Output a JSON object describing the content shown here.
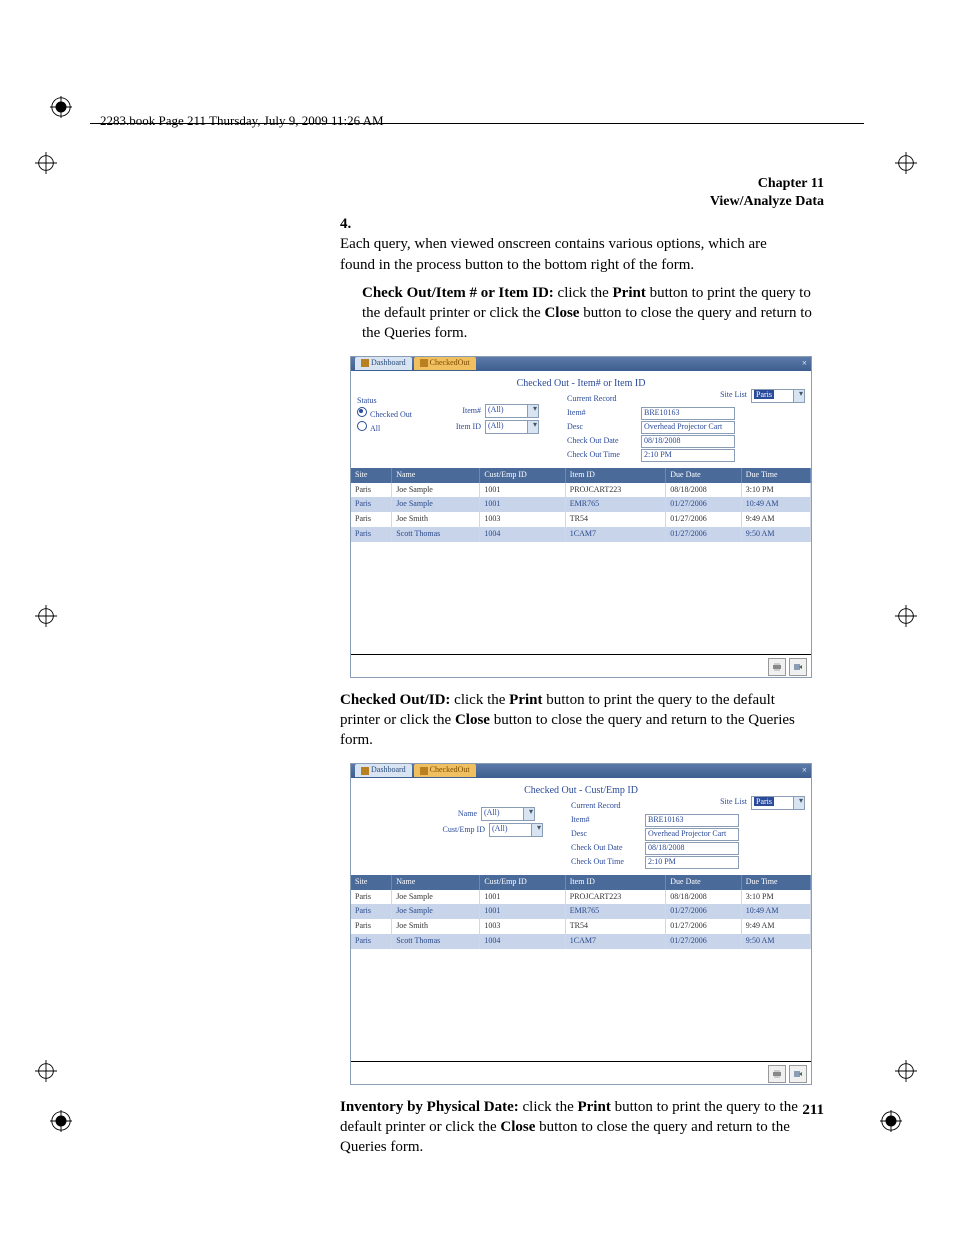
{
  "page_header": "2283.book  Page 211  Thursday, July 9, 2009  11:26 AM",
  "chapter": {
    "num": "Chapter 11",
    "title": "View/Analyze Data"
  },
  "page_number": "211",
  "step_number": "4.",
  "step_text": "Each query, when viewed onscreen contains various options, which are found in the process button to the bottom right of the form.",
  "para1": {
    "bold": "Check Out/Item # or Item ID:",
    "rest": " click the ",
    "b2": "Print",
    "rest2": " button to print the query to the default printer or click the ",
    "b3": "Close",
    "rest3": " button to close the query and return to the Queries form."
  },
  "para2": {
    "bold": "Checked Out/ID:",
    "rest": " click the ",
    "b2": "Print",
    "rest2": " button to print the query to the default printer or click the ",
    "b3": "Close",
    "rest3": " button to close the query and return to the Queries form."
  },
  "para3": {
    "bold": "Inventory by Physical Date:",
    "rest": " click the ",
    "b2": "Print",
    "rest2": " button to print the query to the default printer or click the ",
    "b3": "Close",
    "rest3": " button to close the query and return to the Queries form."
  },
  "shot1": {
    "tabs": {
      "dashboard": "Dashboard",
      "active": "CheckedOut"
    },
    "title": "Checked Out - Item# or Item ID",
    "site_label": "Site List",
    "site_value": "Paris",
    "status_label": "Status",
    "status_opts": {
      "checked_out": "Checked Out",
      "all": "All"
    },
    "filters": {
      "item_num_label": "Item#",
      "item_id_label": "Item ID",
      "all": "(All)"
    },
    "current": {
      "title": "Current Record",
      "item_num_label": "Item#",
      "item_num": "BRE10163",
      "desc_label": "Desc",
      "desc": "Overhead Projector Cart",
      "cod_label": "Check Out Date",
      "cod": "08/18/2008",
      "cot_label": "Check Out Time",
      "cot": "2:10 PM"
    },
    "cols": {
      "site": "Site",
      "name": "Name",
      "custemp": "Cust/Emp ID",
      "itemid": "Item ID",
      "duedate": "Due Date",
      "duetime": "Due Time"
    },
    "rows": [
      {
        "site": "Paris",
        "name": "Joe Sample",
        "cust": "1001",
        "item": "PROJCART223",
        "dd": "08/18/2008",
        "dt": "3:10 PM"
      },
      {
        "site": "Paris",
        "name": "Joe Sample",
        "cust": "1001",
        "item": "EMR765",
        "dd": "01/27/2006",
        "dt": "10:49 AM"
      },
      {
        "site": "Paris",
        "name": "Joe Smith",
        "cust": "1003",
        "item": "TR54",
        "dd": "01/27/2006",
        "dt": "9:49 AM"
      },
      {
        "site": "Paris",
        "name": "Scott Thomas",
        "cust": "1004",
        "item": "1CAM7",
        "dd": "01/27/2006",
        "dt": "9:50 AM"
      }
    ]
  },
  "shot2": {
    "tabs": {
      "dashboard": "Dashboard",
      "active": "CheckedOut"
    },
    "title": "Checked Out - Cust/Emp ID",
    "site_label": "Site List",
    "site_value": "Paris",
    "filters": {
      "name_label": "Name",
      "custemp_label": "Cust/Emp ID",
      "all": "(All)"
    },
    "current": {
      "title": "Current Record",
      "item_num_label": "Item#",
      "item_num": "BRE10163",
      "desc_label": "Desc",
      "desc": "Overhead Projector Cart",
      "cod_label": "Check Out Date",
      "cod": "08/18/2008",
      "cot_label": "Check Out Time",
      "cot": "2:10 PM"
    },
    "cols": {
      "site": "Site",
      "name": "Name",
      "custemp": "Cust/Emp ID",
      "itemid": "Item ID",
      "duedate": "Due Date",
      "duetime": "Due Time"
    },
    "rows": [
      {
        "site": "Paris",
        "name": "Joe Sample",
        "cust": "1001",
        "item": "PROJCART223",
        "dd": "08/18/2008",
        "dt": "3:10 PM"
      },
      {
        "site": "Paris",
        "name": "Joe Sample",
        "cust": "1001",
        "item": "EMR765",
        "dd": "01/27/2006",
        "dt": "10:49 AM"
      },
      {
        "site": "Paris",
        "name": "Joe Smith",
        "cust": "1003",
        "item": "TR54",
        "dd": "01/27/2006",
        "dt": "9:49 AM"
      },
      {
        "site": "Paris",
        "name": "Scott Thomas",
        "cust": "1004",
        "item": "1CAM7",
        "dd": "01/27/2006",
        "dt": "9:50 AM"
      }
    ]
  }
}
